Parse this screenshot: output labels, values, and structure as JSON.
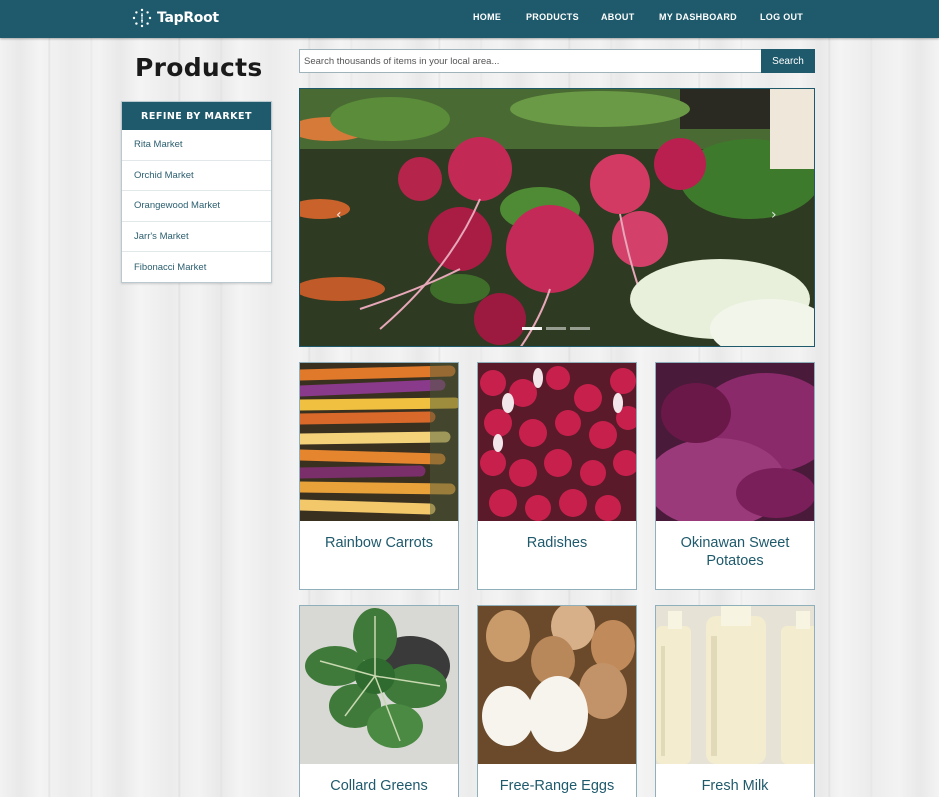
{
  "brand": {
    "name": "TapRoot",
    "logo_icon": "dotted-circle-logo-icon"
  },
  "nav": {
    "items": [
      {
        "label": "HOME"
      },
      {
        "label": "PRODUCTS"
      },
      {
        "label": "ABOUT"
      },
      {
        "label": "MY DASHBOARD"
      },
      {
        "label": "LOG OUT"
      }
    ]
  },
  "page": {
    "title": "Products"
  },
  "refine": {
    "header": "REFINE BY MARKET",
    "markets": [
      {
        "label": "Rita Market"
      },
      {
        "label": "Orchid Market"
      },
      {
        "label": "Orangewood Market"
      },
      {
        "label": "Jarr's Market"
      },
      {
        "label": "Fibonacci Market"
      }
    ]
  },
  "search": {
    "placeholder": "Search thousands of items in your local area...",
    "button_label": "Search"
  },
  "carousel": {
    "prev_icon": "chevron-left-icon",
    "next_icon": "chevron-right-icon",
    "prev_glyph": "‹",
    "next_glyph": "›",
    "active_slide": 1,
    "slide_count": 3
  },
  "products": [
    {
      "name": "Rainbow Carrots"
    },
    {
      "name": "Radishes"
    },
    {
      "name": "Okinawan Sweet Potatoes"
    },
    {
      "name": "Collard Greens"
    },
    {
      "name": "Free-Range Eggs"
    },
    {
      "name": "Fresh Milk"
    }
  ],
  "colors": {
    "primary": "#1f5a6c",
    "link": "#2c5f6f",
    "card_border": "#8fb0bb"
  }
}
